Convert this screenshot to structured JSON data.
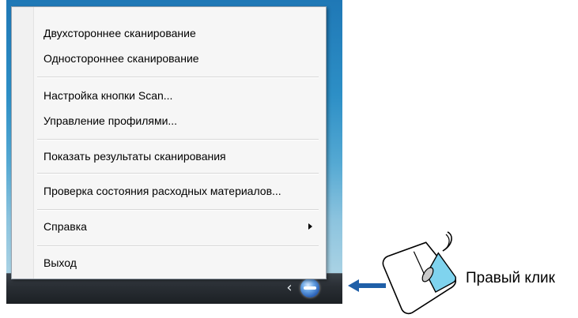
{
  "context_menu": {
    "items": [
      {
        "label": "Двухстороннее сканирование"
      },
      {
        "label": "Одностороннее сканирование"
      },
      {
        "label": "Настройка кнопки Scan..."
      },
      {
        "label": "Управление профилями..."
      },
      {
        "label": "Показать результаты сканирования"
      },
      {
        "label": "Проверка состояния расходных материалов..."
      },
      {
        "label": "Справка",
        "has_submenu": true
      },
      {
        "label": "Выход"
      }
    ]
  },
  "taskbar": {
    "tray_icons": [
      "show-hidden-icons-chevron",
      "scan-tray-icon"
    ]
  },
  "annotation": {
    "action_label": "Правый клик",
    "arrow_color": "#1f5fa8",
    "mouse_button_highlight_color": "#7fd3ee"
  }
}
